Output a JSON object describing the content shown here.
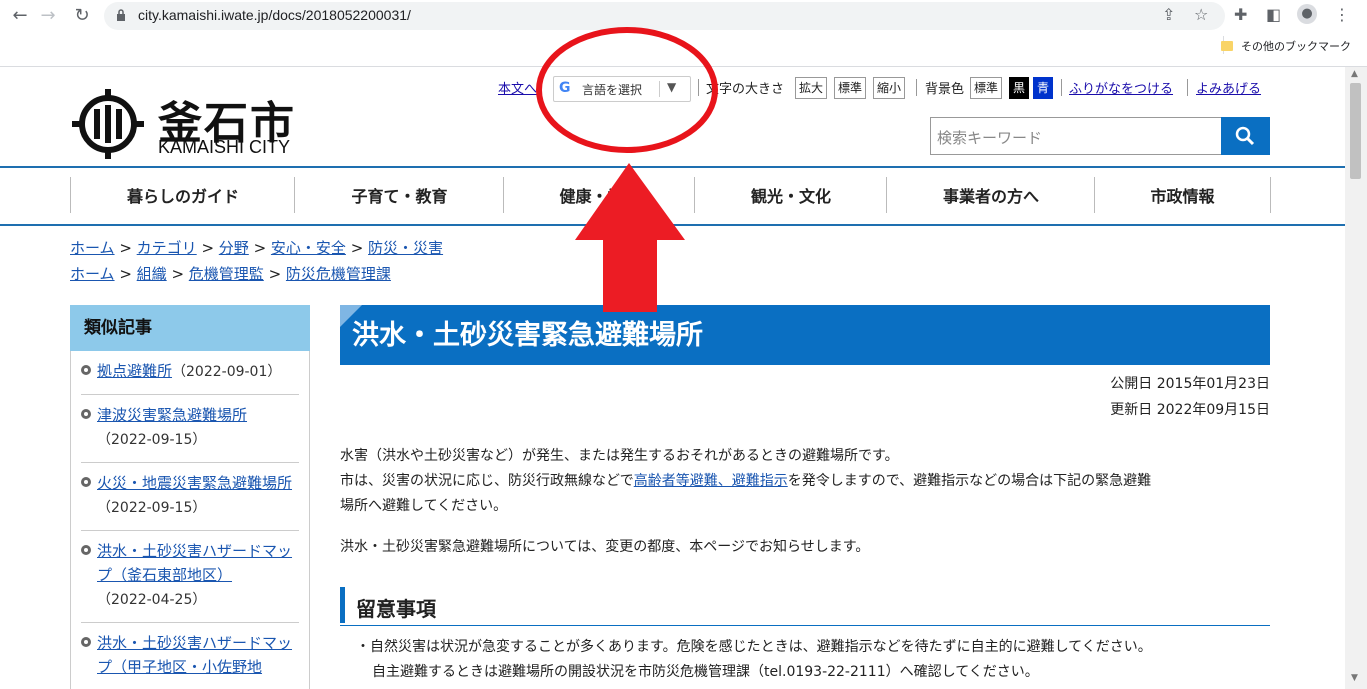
{
  "browser": {
    "url": "city.kamaishi.iwate.jp/docs/2018052200031/",
    "bookmark_folder": "その他のブックマーク"
  },
  "header": {
    "logo_jp": "釜石市",
    "logo_en": "KAMAISHI CITY",
    "skip_link": "本文へ",
    "translate_label": "言語を選択",
    "font_size_label": "文字の大きさ",
    "font_size_buttons": [
      "拡大",
      "標準",
      "縮小"
    ],
    "bg_color_label": "背景色",
    "bg_buttons": [
      "標準",
      "黒",
      "青"
    ],
    "furigana_link": "ふりがなをつける",
    "read_aloud_link": "よみあげる",
    "search_placeholder": "検索キーワード"
  },
  "global_nav": [
    "暮らしのガイド",
    "子育て・教育",
    "健康・福祉",
    "観光・文化",
    "事業者の方へ",
    "市政情報"
  ],
  "breadcrumbs": [
    [
      "ホーム",
      "カテゴリ",
      "分野",
      "安心・安全",
      "防災・災害"
    ],
    [
      "ホーム",
      "組織",
      "危機管理監",
      "防災危機管理課"
    ]
  ],
  "sidebar": {
    "title": "類似記事",
    "items": [
      {
        "title": "拠点避難所",
        "date": "（2022-09-01）"
      },
      {
        "title": "津波災害緊急避難場所",
        "date": "（2022-09-15）"
      },
      {
        "title": "火災・地震災害緊急避難場所",
        "date": "（2022-09-15）"
      },
      {
        "title": "洪水・土砂災害ハザードマップ（釜石東部地区）",
        "date": "（2022-04-25）"
      },
      {
        "title": "洪水・土砂災害ハザードマップ（甲子地区・小佐野地",
        "date": ""
      }
    ]
  },
  "article": {
    "title": "洪水・土砂災害緊急避難場所",
    "published": "公開日 2015年01月23日",
    "updated": "更新日 2022年09月15日",
    "p1_line1": "水害（洪水や土砂災害など）が発生、または発生するおそれがあるときの避難場所です。",
    "p1_line2_pre": "市は、災害の状況に応じ、防災行政無線などで",
    "p1_link": "高齢者等避難、避難指示",
    "p1_line2_post": "を発令しますので、避難指示などの場合は下記の緊急避難",
    "p1_line3": "場所へ避難してください。",
    "p2": "洪水・土砂災害緊急避難場所については、変更の都度、本ページでお知らせします。",
    "section_title": "留意事項",
    "note_line1": "・自然災害は状況が急変することが多くあります。危険を感じたときは、避難指示などを待たずに自主的に避難してください。",
    "note_line2": "自主避難するときは避難場所の開設状況を市防災危機管理課（tel.0193-22-2111）へ確認してください。"
  },
  "annotation": {
    "circle_color": "#e8141b",
    "arrow_color": "#ec1c24"
  }
}
